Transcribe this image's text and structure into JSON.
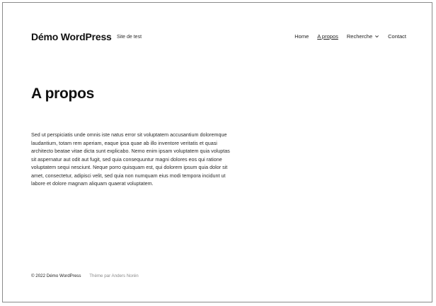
{
  "header": {
    "site_title": "Démo WordPress",
    "tagline": "Site de test",
    "nav": {
      "home": "Home",
      "about": "A propos",
      "search": "Recherche",
      "contact": "Contact"
    },
    "dropdown_icon": "chevron-down"
  },
  "main": {
    "title": "A propos",
    "paragraph": "Sed ut perspiciatis unde omnis iste natus error sit voluptatem accusantium doloremque laudantium, totam rem aperiam, eaque ipsa quae ab illo inventore veritatis et quasi architecto beatae vitae dicta sunt explicabo. Nemo enim ipsam voluptatem quia voluptas sit aspernatur aut odit aut fugit, sed quia consequuntur magni dolores eos qui ratione voluptatem sequi nesciunt. Neque porro quisquam est, qui dolorem ipsum quia dolor sit amet, consectetur, adipisci velit, sed quia non numquam eius modi tempora incidunt ut labore et dolore magnam aliquam quaerat voluptatem."
  },
  "footer": {
    "copyright": "© 2022 Démo WordPress",
    "credit": "Thème par Anders Norén"
  }
}
